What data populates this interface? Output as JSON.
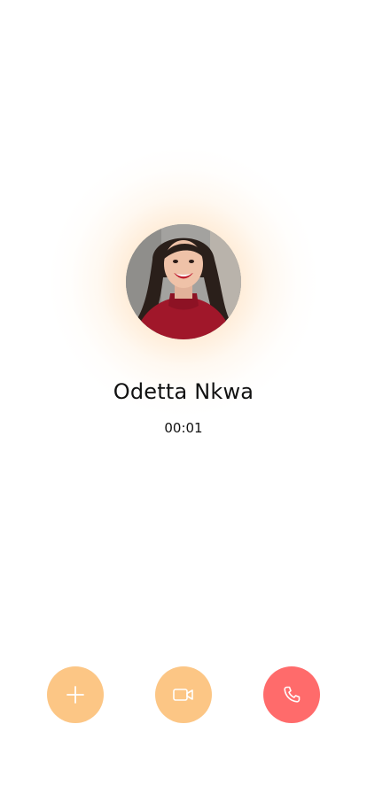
{
  "call": {
    "caller_name": "Odetta Nkwa",
    "duration": "00:01"
  },
  "avatar": {
    "description_icon": "caller-photo"
  },
  "actions": [
    {
      "id": "add",
      "icon": "plus-icon",
      "color": "#fcc685"
    },
    {
      "id": "video",
      "icon": "video-camera-icon",
      "color": "#fcc685"
    },
    {
      "id": "end",
      "icon": "phone-icon",
      "color": "#ff6b6b"
    }
  ],
  "colors": {
    "accent": "#fcc685",
    "end_call": "#ff6b6b",
    "glow": "#ffb96e"
  }
}
